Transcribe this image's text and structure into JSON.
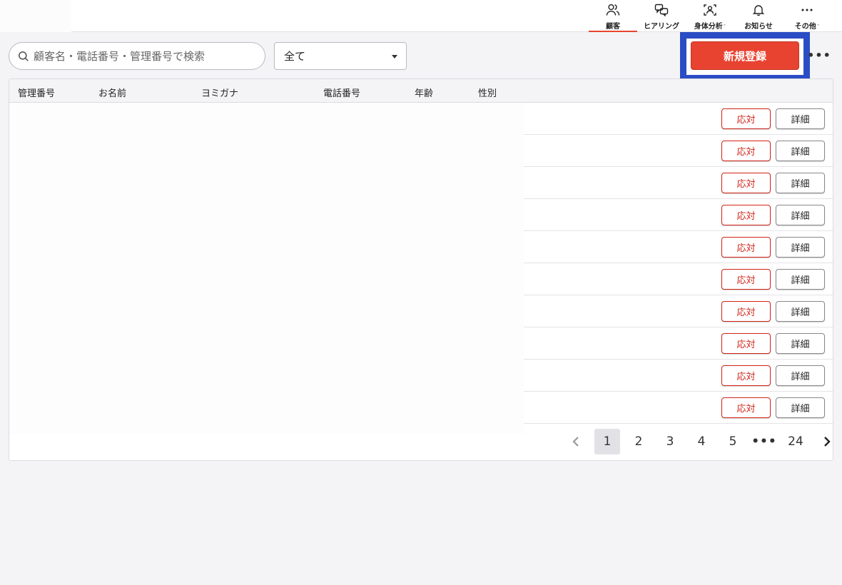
{
  "nav": {
    "items": [
      {
        "label": "顧客",
        "icon": "users-icon",
        "active": true,
        "dropdown": false
      },
      {
        "label": "ヒアリング",
        "icon": "chat-icon",
        "active": false,
        "dropdown": false
      },
      {
        "label": "身体分析",
        "icon": "body-scan-icon",
        "active": false,
        "dropdown": true
      },
      {
        "label": "お知らせ",
        "icon": "bell-icon",
        "active": false,
        "dropdown": false
      },
      {
        "label": "その他",
        "icon": "more-horizontal-icon",
        "active": false,
        "dropdown": true
      }
    ],
    "caret": "ˇ"
  },
  "search": {
    "placeholder": "顧客名・電話番号・管理番号で検索",
    "value": ""
  },
  "filter": {
    "selected": "全て"
  },
  "toolbar": {
    "new_label": "新規登録",
    "more_label": "•••"
  },
  "table": {
    "columns": [
      "管理番号",
      "お名前",
      "ヨミガナ",
      "電話番号",
      "年齢",
      "性別"
    ],
    "row_count": 10,
    "action_label": "応対",
    "detail_label": "詳細"
  },
  "pagination": {
    "prev": "‹",
    "pages": [
      "1",
      "2",
      "3",
      "4",
      "5"
    ],
    "ellipsis": "•••",
    "last": "24",
    "next": "›",
    "current": "1"
  },
  "colors": {
    "accent": "#e84330",
    "action_red": "#cf2417",
    "highlight": "#2a4cc4"
  }
}
